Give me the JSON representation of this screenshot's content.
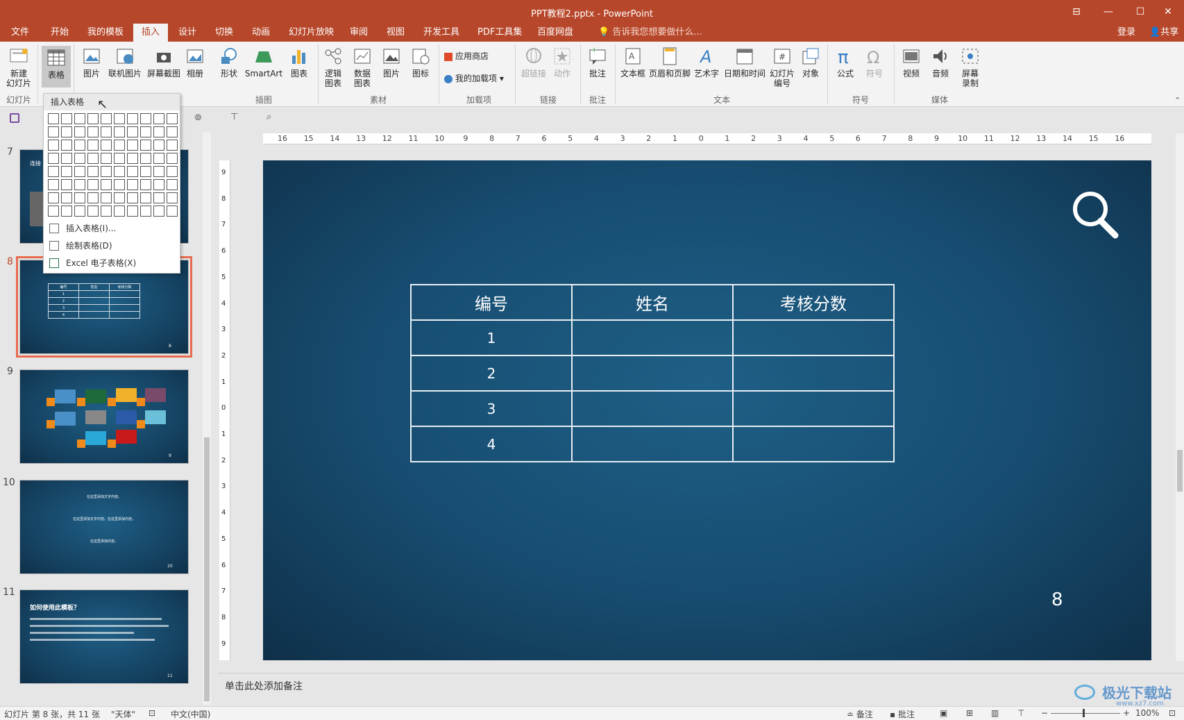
{
  "window": {
    "title": "PPT教程2.pptx - PowerPoint",
    "account": "登录",
    "share": "共享"
  },
  "tabs": [
    "文件",
    "开始",
    "我的模板",
    "插入",
    "设计",
    "切换",
    "动画",
    "幻灯片放映",
    "审阅",
    "视图",
    "开发工具",
    "PDF工具集",
    "百度网盘"
  ],
  "active_tab": "插入",
  "tell_me": "告诉我您想要做什么...",
  "ribbon": {
    "buttons": [
      {
        "label": "新建\n幻灯片",
        "icon": "new-slide-icon"
      },
      {
        "label": "表格",
        "icon": "table-icon"
      },
      {
        "label": "图片",
        "icon": "picture-icon"
      },
      {
        "label": "联机图片",
        "icon": "online-picture-icon"
      },
      {
        "label": "屏幕截图",
        "icon": "screenshot-icon"
      },
      {
        "label": "相册",
        "icon": "album-icon"
      },
      {
        "label": "形状",
        "icon": "shapes-icon"
      },
      {
        "label": "SmartArt",
        "icon": "smartart-icon"
      },
      {
        "label": "图表",
        "icon": "chart-icon"
      },
      {
        "label": "逻辑\n图表",
        "icon": "logic-chart-icon"
      },
      {
        "label": "数据\n图表",
        "icon": "data-chart-icon"
      },
      {
        "label": "图片",
        "icon": "picture2-icon"
      },
      {
        "label": "图标",
        "icon": "icons-icon"
      },
      {
        "label": "超链接",
        "icon": "hyperlink-icon"
      },
      {
        "label": "动作",
        "icon": "action-icon"
      },
      {
        "label": "批注",
        "icon": "comment-icon"
      },
      {
        "label": "文本框",
        "icon": "textbox-icon"
      },
      {
        "label": "页眉和页脚",
        "icon": "header-footer-icon"
      },
      {
        "label": "艺术字",
        "icon": "wordart-icon"
      },
      {
        "label": "日期和时间",
        "icon": "datetime-icon"
      },
      {
        "label": "幻灯片\n编号",
        "icon": "slide-number-icon"
      },
      {
        "label": "对象",
        "icon": "object-icon"
      },
      {
        "label": "公式",
        "icon": "equation-icon"
      },
      {
        "label": "符号",
        "icon": "symbol-icon"
      },
      {
        "label": "视频",
        "icon": "video-icon"
      },
      {
        "label": "音频",
        "icon": "audio-icon"
      },
      {
        "label": "屏幕\n录制",
        "icon": "screen-record-icon"
      }
    ],
    "addins": [
      "应用商店",
      "我的加载项"
    ],
    "groups": [
      "幻灯片",
      "插图",
      "素材",
      "加载项",
      "链接",
      "批注",
      "文本",
      "符号",
      "媒体"
    ]
  },
  "dropdown": {
    "header": "插入表格",
    "items": [
      "插入表格(I)...",
      "绘制表格(D)",
      "Excel 电子表格(X)"
    ]
  },
  "thumbs": [
    {
      "num": "7",
      "title": "连接"
    },
    {
      "num": "8",
      "labels": [
        "编号",
        "姓名",
        "考核分数"
      ],
      "rows": [
        "1",
        "2",
        "3",
        "4"
      ],
      "page": "8"
    },
    {
      "num": "9",
      "page": "9"
    },
    {
      "num": "10",
      "lines": [
        "在这里添加文字内容。",
        "在这里添加文字内容。在这里添加内容。",
        "在这里添加内容。"
      ],
      "page": "10"
    },
    {
      "num": "11",
      "title": "如何使用此模板？",
      "page": "11"
    }
  ],
  "ruler_h": [
    "16",
    "15",
    "14",
    "13",
    "12",
    "11",
    "10",
    "9",
    "8",
    "7",
    "6",
    "5",
    "4",
    "3",
    "2",
    "1",
    "0",
    "1",
    "2",
    "3",
    "4",
    "5",
    "6",
    "7",
    "8",
    "9",
    "10",
    "11",
    "12",
    "13",
    "14",
    "15",
    "16"
  ],
  "ruler_v": [
    "9",
    "8",
    "7",
    "6",
    "5",
    "4",
    "3",
    "2",
    "1",
    "0",
    "1",
    "2",
    "3",
    "4",
    "5",
    "6",
    "7",
    "8",
    "9"
  ],
  "slide": {
    "headers": [
      "编号",
      "姓名",
      "考核分数"
    ],
    "rows": [
      [
        "1",
        "",
        ""
      ],
      [
        "2",
        "",
        ""
      ],
      [
        "3",
        "",
        ""
      ],
      [
        "4",
        "",
        ""
      ]
    ],
    "page_number": "8"
  },
  "notes_placeholder": "单击此处添加备注",
  "status": {
    "slide_info": "幻灯片 第 8 张，共 11 张",
    "theme": "\"天体\"",
    "language": "中文(中国)",
    "notes": "备注",
    "comments": "批注",
    "zoom": "100%"
  },
  "watermark": {
    "text": "极光下载站",
    "url": "www.xz7.com"
  }
}
